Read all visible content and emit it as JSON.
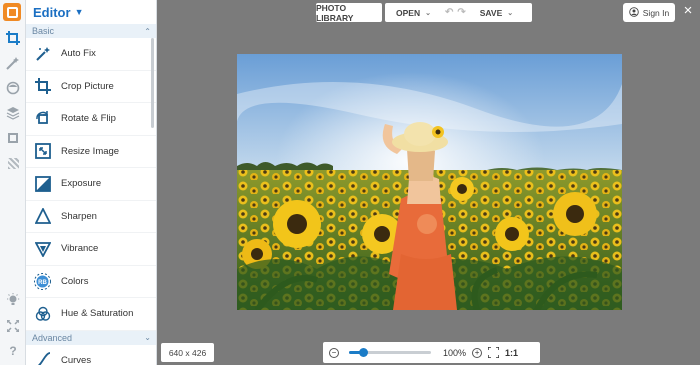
{
  "app": {
    "title": "Editor"
  },
  "rail": {
    "icons": [
      "logo-icon",
      "crop-icon",
      "magic-wand-icon",
      "face-icon",
      "layers-icon",
      "frame-icon",
      "texture-icon",
      "light-bulb-icon",
      "fullscreen-icon",
      "help-icon"
    ]
  },
  "panel": {
    "section_basic": "Basic",
    "section_advanced": "Advanced",
    "tools": [
      {
        "label": "Auto Fix",
        "icon": "magic-wand-icon"
      },
      {
        "label": "Crop Picture",
        "icon": "crop-icon"
      },
      {
        "label": "Rotate & Flip",
        "icon": "rotate-icon"
      },
      {
        "label": "Resize Image",
        "icon": "resize-icon"
      },
      {
        "label": "Exposure",
        "icon": "exposure-icon"
      },
      {
        "label": "Sharpen",
        "icon": "sharpen-icon"
      },
      {
        "label": "Vibrance",
        "icon": "vibrance-icon"
      },
      {
        "label": "Colors",
        "icon": "colors-icon"
      },
      {
        "label": "Hue & Saturation",
        "icon": "hue-icon"
      }
    ],
    "advanced_tools": [
      {
        "label": "Curves",
        "icon": "curves-icon"
      }
    ]
  },
  "toolbar": {
    "photo_library": "PHOTO LIBRARY",
    "open": "OPEN",
    "save": "SAVE",
    "sign_in": "Sign In"
  },
  "canvas": {
    "image_size": "640 x 426"
  },
  "zoom": {
    "level": "100%",
    "fit_label": "1:1",
    "slider_fraction": 0.18
  },
  "colors": {
    "accent": "#1b7cc7",
    "brand": "#f08a24",
    "workspace": "#7b7b7b"
  }
}
